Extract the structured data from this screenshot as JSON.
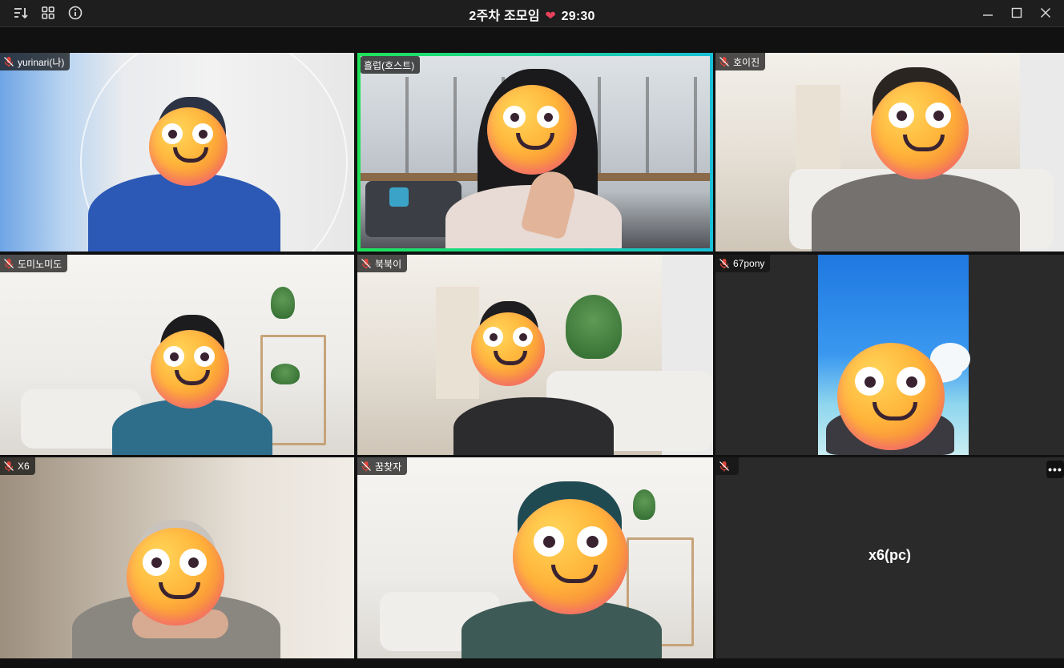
{
  "window": {
    "title_prefix": "2주차 조모임",
    "title_heart": "❤",
    "timer": "29:30"
  },
  "toolbar": {
    "icons": [
      "sort-icon",
      "grid-view-icon",
      "info-icon"
    ]
  },
  "window_controls": [
    "minimize-icon",
    "maximize-icon",
    "close-icon"
  ],
  "tiles": [
    {
      "name": "yurinari(나)",
      "muted": true
    },
    {
      "name": "흘럽(호스트)",
      "muted": false,
      "speaking": true
    },
    {
      "name": "호이진",
      "muted": true
    },
    {
      "name": "도미노미도",
      "muted": true
    },
    {
      "name": "북북이",
      "muted": true
    },
    {
      "name": "67pony",
      "muted": true
    },
    {
      "name": "X6",
      "muted": true
    },
    {
      "name": "꿈찾자",
      "muted": true
    },
    {
      "name": "",
      "muted": true,
      "camera_off": true,
      "display_name": "x6(pc)",
      "more": "•••"
    }
  ],
  "colors": {
    "speaking_border": "#17d45a",
    "mic_muted": "#e0453a",
    "heart": "#e8415a"
  }
}
